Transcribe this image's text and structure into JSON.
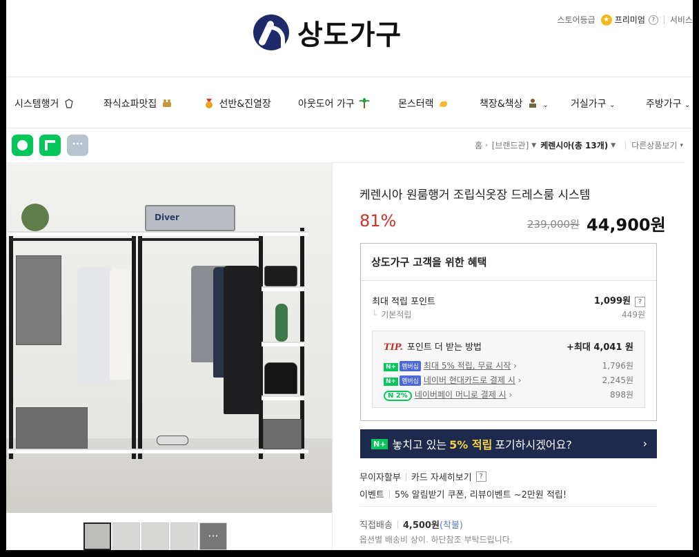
{
  "header": {
    "brand": "상도가구",
    "store_grade_label": "스토어등급",
    "grade_value": "프리미엄",
    "service_link": "서비스"
  },
  "nav": {
    "items": [
      {
        "label": "시스템행거",
        "icon": "hanger-icon"
      },
      {
        "label": "좌식쇼파맛집",
        "icon": "sofa-icon"
      },
      {
        "label": "선반&진열장",
        "icon": "medal-icon"
      },
      {
        "label": "아웃도어 가구",
        "icon": "palm-tree-icon"
      },
      {
        "label": "몬스터랙",
        "icon": "muscle-icon"
      },
      {
        "label": "책장&책상",
        "icon": "reading-icon"
      },
      {
        "label": "거실가구",
        "icon": ""
      },
      {
        "label": "주방가구",
        "icon": ""
      }
    ]
  },
  "share": {
    "more": "···"
  },
  "breadcrumb": {
    "home": "홈",
    "brand": "[브랜드관]",
    "current": "케렌시아(총 13개)",
    "other": "다른상품보기"
  },
  "photo": {
    "case_text": "Diver",
    "more_thumb": "···"
  },
  "product": {
    "title": "케렌시아 원룸행거 조립식옷장 드레스룸 시스템",
    "discount": "81%",
    "original_price": "239,000원",
    "price": "44,900원"
  },
  "benefit": {
    "heading": "상도가구 고객을 위한 혜택",
    "max_points_label": "최대 적립 포인트",
    "max_points_value": "1,099원",
    "help": "?",
    "base_label": "기본적립",
    "base_value": "449원",
    "tip_label": "TIP.",
    "tip_heading": "포인트 더 받는 방법",
    "tip_max": "+최대 4,041 원",
    "tips": [
      {
        "badge": "N+",
        "tag": "멤버십",
        "label": "최대 5% 적립, 무료 시작",
        "value": "1,796원"
      },
      {
        "badge": "N+",
        "tag": "멤버십",
        "label": "네이버 현대카드로 결제 시",
        "value": "2,245원"
      },
      {
        "badge": "N 2%",
        "tag": "",
        "label": "네이버페이 머니로 결제 시",
        "value": "898원"
      }
    ]
  },
  "banner": {
    "badge": "N+",
    "text_before": "놓치고 있는",
    "highlight": "5% 적립",
    "text_after": "포기하시겠어요?"
  },
  "misc": {
    "installment": "무이자할부",
    "card_detail": "카드 자세히보기",
    "event_label": "이벤트",
    "event_text": "5% 알림받기 쿠폰, 리뷰이벤트 ~2만원 적립!",
    "shipping_label": "직접배송",
    "shipping_price": "4,500원",
    "shipping_note": "(착불)",
    "shipping_sub": "옵션별 배송비 상이. 하단참조 부탁드립니다."
  },
  "colors": {
    "accent_red": "#d0302c",
    "naver_green": "#03c75a",
    "banner_navy": "#1d2a4d",
    "brand_navy": "#1f2a6b"
  }
}
